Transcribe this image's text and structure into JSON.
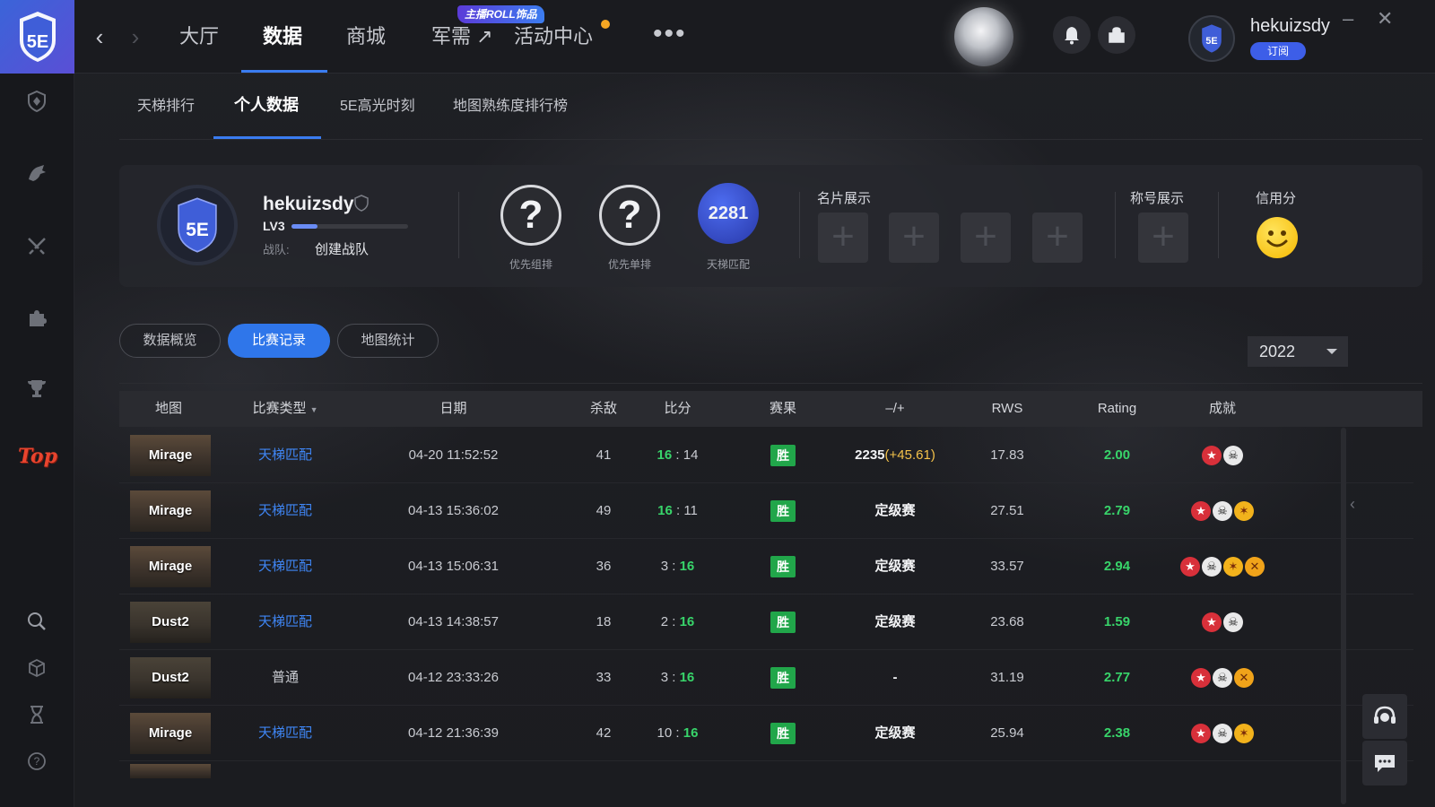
{
  "window": {
    "minimize_label": "–",
    "close_label": "✕"
  },
  "nav": {
    "back_icon": "chevron-left-icon",
    "forward_icon": "chevron-right-icon",
    "items": [
      {
        "label": "大厅"
      },
      {
        "label": "数据"
      },
      {
        "label": "商城"
      },
      {
        "label": "军需 ↗"
      },
      {
        "label": "活动中心"
      }
    ],
    "active": "数据",
    "promo_badge": "主播ROLL饰品",
    "more_label": "•••",
    "accent_color": "#3a7cf0"
  },
  "user": {
    "username": "hekuizsdy",
    "subscribe_label": "订阅"
  },
  "subtabs": [
    {
      "label": "天梯排行"
    },
    {
      "label": "个人数据"
    },
    {
      "label": "5E高光时刻"
    },
    {
      "label": "地图熟练度排行榜"
    }
  ],
  "profile": {
    "name": "hekuizsdy",
    "level": "LV3",
    "level_progress": 0.22,
    "team_label": "战队:",
    "team_value": "创建战队",
    "ranks": [
      {
        "value": "?",
        "label": "优先组排"
      },
      {
        "value": "?",
        "label": "优先单排"
      },
      {
        "value": "2281",
        "label": "天梯匹配"
      }
    ],
    "card_display_title": "名片展示",
    "title_display_title": "称号展示",
    "credit_title": "信用分",
    "plus": "+"
  },
  "filters": {
    "pills": [
      {
        "label": "数据概览"
      },
      {
        "label": "比赛记录"
      },
      {
        "label": "地图统计"
      }
    ],
    "active": "比赛记录",
    "year": "2022"
  },
  "table": {
    "headers": [
      "地图",
      "比赛类型",
      "日期",
      "杀敌",
      "比分",
      "赛果",
      "–/+",
      "RWS",
      "Rating",
      "成就"
    ],
    "rows": [
      {
        "map": "Mirage",
        "type": "天梯匹配",
        "date": "04-20 11:52:52",
        "kills": "41",
        "score_a": "16",
        "score_b": "14",
        "win_side": "a",
        "result": "胜",
        "elo": "2235",
        "elo_delta": "(+45.61)",
        "rws": "17.83",
        "rating": "2.00",
        "ach": [
          "star",
          "skull"
        ]
      },
      {
        "map": "Mirage",
        "type": "天梯匹配",
        "date": "04-13 15:36:02",
        "kills": "49",
        "score_a": "16",
        "score_b": "11",
        "win_side": "a",
        "result": "胜",
        "elo": "定级赛",
        "elo_delta": "",
        "rws": "27.51",
        "rating": "2.79",
        "ach": [
          "star",
          "skull",
          "fire"
        ]
      },
      {
        "map": "Mirage",
        "type": "天梯匹配",
        "date": "04-13 15:06:31",
        "kills": "36",
        "score_a": "3",
        "score_b": "16",
        "win_side": "b",
        "result": "胜",
        "elo": "定级赛",
        "elo_delta": "",
        "rws": "33.57",
        "rating": "2.94",
        "ach": [
          "star",
          "skull",
          "fire",
          "claw"
        ]
      },
      {
        "map": "Dust2",
        "type": "天梯匹配",
        "date": "04-13 14:38:57",
        "kills": "18",
        "score_a": "2",
        "score_b": "16",
        "win_side": "b",
        "result": "胜",
        "elo": "定级赛",
        "elo_delta": "",
        "rws": "23.68",
        "rating": "1.59",
        "ach": [
          "star",
          "skull"
        ]
      },
      {
        "map": "Dust2",
        "type": "普通",
        "date": "04-12 23:33:26",
        "kills": "33",
        "score_a": "3",
        "score_b": "16",
        "win_side": "b",
        "result": "胜",
        "elo": "-",
        "elo_delta": "",
        "rws": "31.19",
        "rating": "2.77",
        "ach": [
          "star",
          "skull",
          "claw"
        ]
      },
      {
        "map": "Mirage",
        "type": "天梯匹配",
        "date": "04-12 21:36:39",
        "kills": "42",
        "score_a": "10",
        "score_b": "16",
        "win_side": "b",
        "result": "胜",
        "elo": "定级赛",
        "elo_delta": "",
        "rws": "25.94",
        "rating": "2.38",
        "ach": [
          "star",
          "skull",
          "fire"
        ]
      }
    ]
  }
}
